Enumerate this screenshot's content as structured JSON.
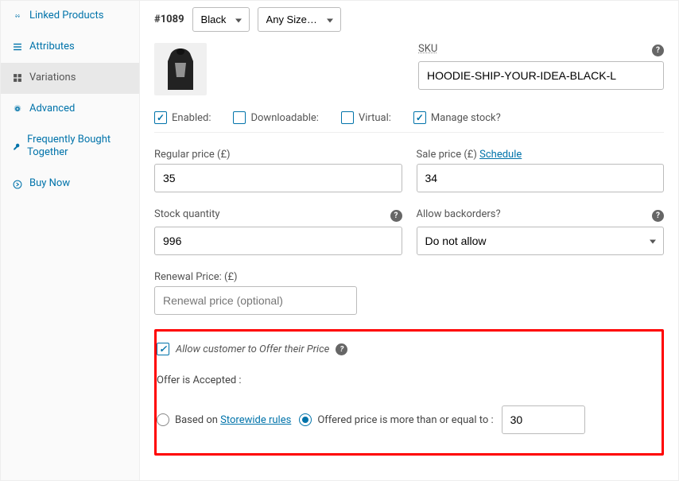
{
  "sidebar": {
    "items": [
      {
        "label": "Linked Products",
        "icon": "link"
      },
      {
        "label": "Attributes",
        "icon": "list"
      },
      {
        "label": "Variations",
        "icon": "grid"
      },
      {
        "label": "Advanced",
        "icon": "gear"
      },
      {
        "label": "Frequently Bought Together",
        "icon": "wrench"
      },
      {
        "label": "Buy Now",
        "icon": "arrow-right"
      }
    ]
  },
  "variation": {
    "id_prefix": "#",
    "id": "1089",
    "attr1": "Black",
    "attr2": "Any Size…"
  },
  "sku": {
    "label": "SKU",
    "value": "HOODIE-SHIP-YOUR-IDEA-BLACK-L"
  },
  "toggles": {
    "enabled": "Enabled:",
    "downloadable": "Downloadable:",
    "virtual": "Virtual:",
    "manage_stock": "Manage stock?"
  },
  "pricing": {
    "regular_label": "Regular price (£)",
    "regular_value": "35",
    "sale_label": "Sale price (£)",
    "sale_value": "34",
    "schedule": "Schedule"
  },
  "stock": {
    "qty_label": "Stock quantity",
    "qty_value": "996",
    "backorders_label": "Allow backorders?",
    "backorders_value": "Do not allow"
  },
  "renewal": {
    "label": "Renewal Price: (£)",
    "placeholder": "Renewal price (optional)"
  },
  "offer": {
    "allow_label": "Allow customer to Offer their Price",
    "accepted_title": "Offer is Accepted :",
    "based_on": "Based on ",
    "storewide": "Storewide rules",
    "threshold_label": "Offered price is more than or equal to :",
    "threshold_value": "30"
  }
}
